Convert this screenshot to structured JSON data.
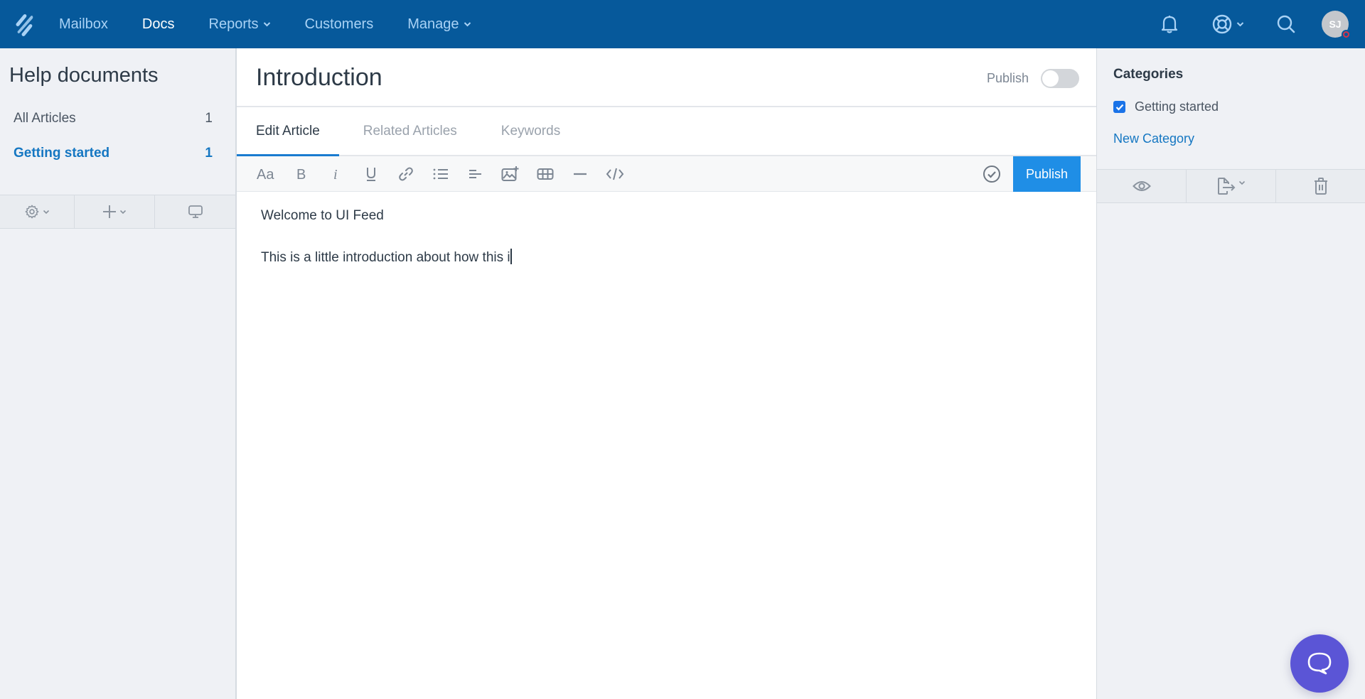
{
  "topnav": {
    "logo": "helpscout-logo-icon",
    "items": [
      {
        "label": "Mailbox",
        "active": false,
        "dropdown": false
      },
      {
        "label": "Docs",
        "active": true,
        "dropdown": false
      },
      {
        "label": "Reports",
        "active": false,
        "dropdown": true
      },
      {
        "label": "Customers",
        "active": false,
        "dropdown": false
      },
      {
        "label": "Manage",
        "active": false,
        "dropdown": true
      }
    ],
    "right_icons": [
      "bell-icon",
      "lifebuoy-icon",
      "search-icon"
    ],
    "avatar_initials": "SJ"
  },
  "sidebar": {
    "title": "Help documents",
    "items": [
      {
        "label": "All Articles",
        "count": "1",
        "active": false
      },
      {
        "label": "Getting started",
        "count": "1",
        "active": true
      }
    ],
    "tools": [
      "gear-icon",
      "plus-icon",
      "monitor-icon"
    ]
  },
  "editor": {
    "title": "Introduction",
    "publish_toggle_label": "Publish",
    "publish_toggle_on": false,
    "tabs": [
      {
        "label": "Edit Article",
        "active": true
      },
      {
        "label": "Related Articles",
        "active": false
      },
      {
        "label": "Keywords",
        "active": false
      }
    ],
    "toolbar": [
      "font-size-icon",
      "bold-icon",
      "italic-icon",
      "underline-icon",
      "link-icon",
      "bulleted-list-icon",
      "align-icon",
      "insert-image-icon",
      "table-icon",
      "horizontal-rule-icon",
      "code-icon"
    ],
    "publish_button": "Publish",
    "content": [
      "Welcome to UI Feed",
      "This is a little introduction about how this i"
    ]
  },
  "right_panel": {
    "title": "Categories",
    "categories": [
      {
        "label": "Getting started",
        "checked": true
      }
    ],
    "new_category_link": "New Category",
    "tools": [
      "eye-icon",
      "export-icon",
      "trash-icon"
    ]
  },
  "colors": {
    "nav_bg": "#06599b",
    "accent": "#1f8ee6",
    "link": "#1577c2",
    "chat_fab": "#5b55d6"
  }
}
